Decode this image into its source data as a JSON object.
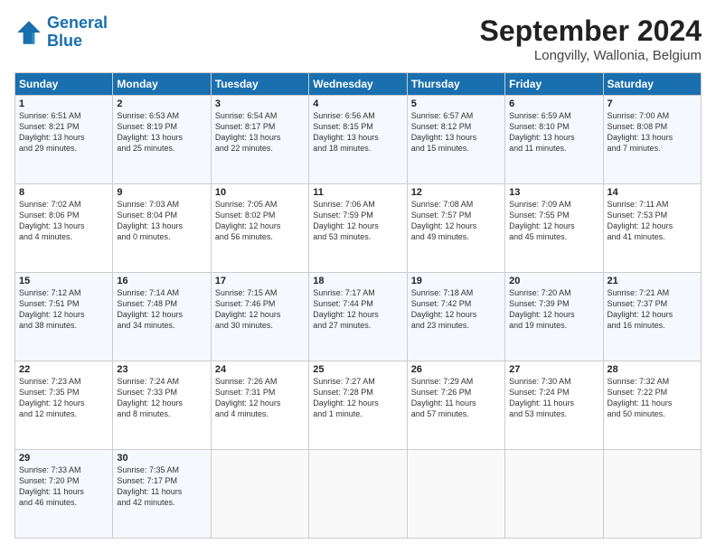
{
  "logo": {
    "line1": "General",
    "line2": "Blue"
  },
  "header": {
    "month": "September 2024",
    "location": "Longvilly, Wallonia, Belgium"
  },
  "weekdays": [
    "Sunday",
    "Monday",
    "Tuesday",
    "Wednesday",
    "Thursday",
    "Friday",
    "Saturday"
  ],
  "weeks": [
    [
      {
        "day": "1",
        "info": "Sunrise: 6:51 AM\nSunset: 8:21 PM\nDaylight: 13 hours\nand 29 minutes."
      },
      {
        "day": "2",
        "info": "Sunrise: 6:53 AM\nSunset: 8:19 PM\nDaylight: 13 hours\nand 25 minutes."
      },
      {
        "day": "3",
        "info": "Sunrise: 6:54 AM\nSunset: 8:17 PM\nDaylight: 13 hours\nand 22 minutes."
      },
      {
        "day": "4",
        "info": "Sunrise: 6:56 AM\nSunset: 8:15 PM\nDaylight: 13 hours\nand 18 minutes."
      },
      {
        "day": "5",
        "info": "Sunrise: 6:57 AM\nSunset: 8:12 PM\nDaylight: 13 hours\nand 15 minutes."
      },
      {
        "day": "6",
        "info": "Sunrise: 6:59 AM\nSunset: 8:10 PM\nDaylight: 13 hours\nand 11 minutes."
      },
      {
        "day": "7",
        "info": "Sunrise: 7:00 AM\nSunset: 8:08 PM\nDaylight: 13 hours\nand 7 minutes."
      }
    ],
    [
      {
        "day": "8",
        "info": "Sunrise: 7:02 AM\nSunset: 8:06 PM\nDaylight: 13 hours\nand 4 minutes."
      },
      {
        "day": "9",
        "info": "Sunrise: 7:03 AM\nSunset: 8:04 PM\nDaylight: 13 hours\nand 0 minutes."
      },
      {
        "day": "10",
        "info": "Sunrise: 7:05 AM\nSunset: 8:02 PM\nDaylight: 12 hours\nand 56 minutes."
      },
      {
        "day": "11",
        "info": "Sunrise: 7:06 AM\nSunset: 7:59 PM\nDaylight: 12 hours\nand 53 minutes."
      },
      {
        "day": "12",
        "info": "Sunrise: 7:08 AM\nSunset: 7:57 PM\nDaylight: 12 hours\nand 49 minutes."
      },
      {
        "day": "13",
        "info": "Sunrise: 7:09 AM\nSunset: 7:55 PM\nDaylight: 12 hours\nand 45 minutes."
      },
      {
        "day": "14",
        "info": "Sunrise: 7:11 AM\nSunset: 7:53 PM\nDaylight: 12 hours\nand 41 minutes."
      }
    ],
    [
      {
        "day": "15",
        "info": "Sunrise: 7:12 AM\nSunset: 7:51 PM\nDaylight: 12 hours\nand 38 minutes."
      },
      {
        "day": "16",
        "info": "Sunrise: 7:14 AM\nSunset: 7:48 PM\nDaylight: 12 hours\nand 34 minutes."
      },
      {
        "day": "17",
        "info": "Sunrise: 7:15 AM\nSunset: 7:46 PM\nDaylight: 12 hours\nand 30 minutes."
      },
      {
        "day": "18",
        "info": "Sunrise: 7:17 AM\nSunset: 7:44 PM\nDaylight: 12 hours\nand 27 minutes."
      },
      {
        "day": "19",
        "info": "Sunrise: 7:18 AM\nSunset: 7:42 PM\nDaylight: 12 hours\nand 23 minutes."
      },
      {
        "day": "20",
        "info": "Sunrise: 7:20 AM\nSunset: 7:39 PM\nDaylight: 12 hours\nand 19 minutes."
      },
      {
        "day": "21",
        "info": "Sunrise: 7:21 AM\nSunset: 7:37 PM\nDaylight: 12 hours\nand 16 minutes."
      }
    ],
    [
      {
        "day": "22",
        "info": "Sunrise: 7:23 AM\nSunset: 7:35 PM\nDaylight: 12 hours\nand 12 minutes."
      },
      {
        "day": "23",
        "info": "Sunrise: 7:24 AM\nSunset: 7:33 PM\nDaylight: 12 hours\nand 8 minutes."
      },
      {
        "day": "24",
        "info": "Sunrise: 7:26 AM\nSunset: 7:31 PM\nDaylight: 12 hours\nand 4 minutes."
      },
      {
        "day": "25",
        "info": "Sunrise: 7:27 AM\nSunset: 7:28 PM\nDaylight: 12 hours\nand 1 minute."
      },
      {
        "day": "26",
        "info": "Sunrise: 7:29 AM\nSunset: 7:26 PM\nDaylight: 11 hours\nand 57 minutes."
      },
      {
        "day": "27",
        "info": "Sunrise: 7:30 AM\nSunset: 7:24 PM\nDaylight: 11 hours\nand 53 minutes."
      },
      {
        "day": "28",
        "info": "Sunrise: 7:32 AM\nSunset: 7:22 PM\nDaylight: 11 hours\nand 50 minutes."
      }
    ],
    [
      {
        "day": "29",
        "info": "Sunrise: 7:33 AM\nSunset: 7:20 PM\nDaylight: 11 hours\nand 46 minutes."
      },
      {
        "day": "30",
        "info": "Sunrise: 7:35 AM\nSunset: 7:17 PM\nDaylight: 11 hours\nand 42 minutes."
      },
      {
        "day": "",
        "info": ""
      },
      {
        "day": "",
        "info": ""
      },
      {
        "day": "",
        "info": ""
      },
      {
        "day": "",
        "info": ""
      },
      {
        "day": "",
        "info": ""
      }
    ]
  ]
}
